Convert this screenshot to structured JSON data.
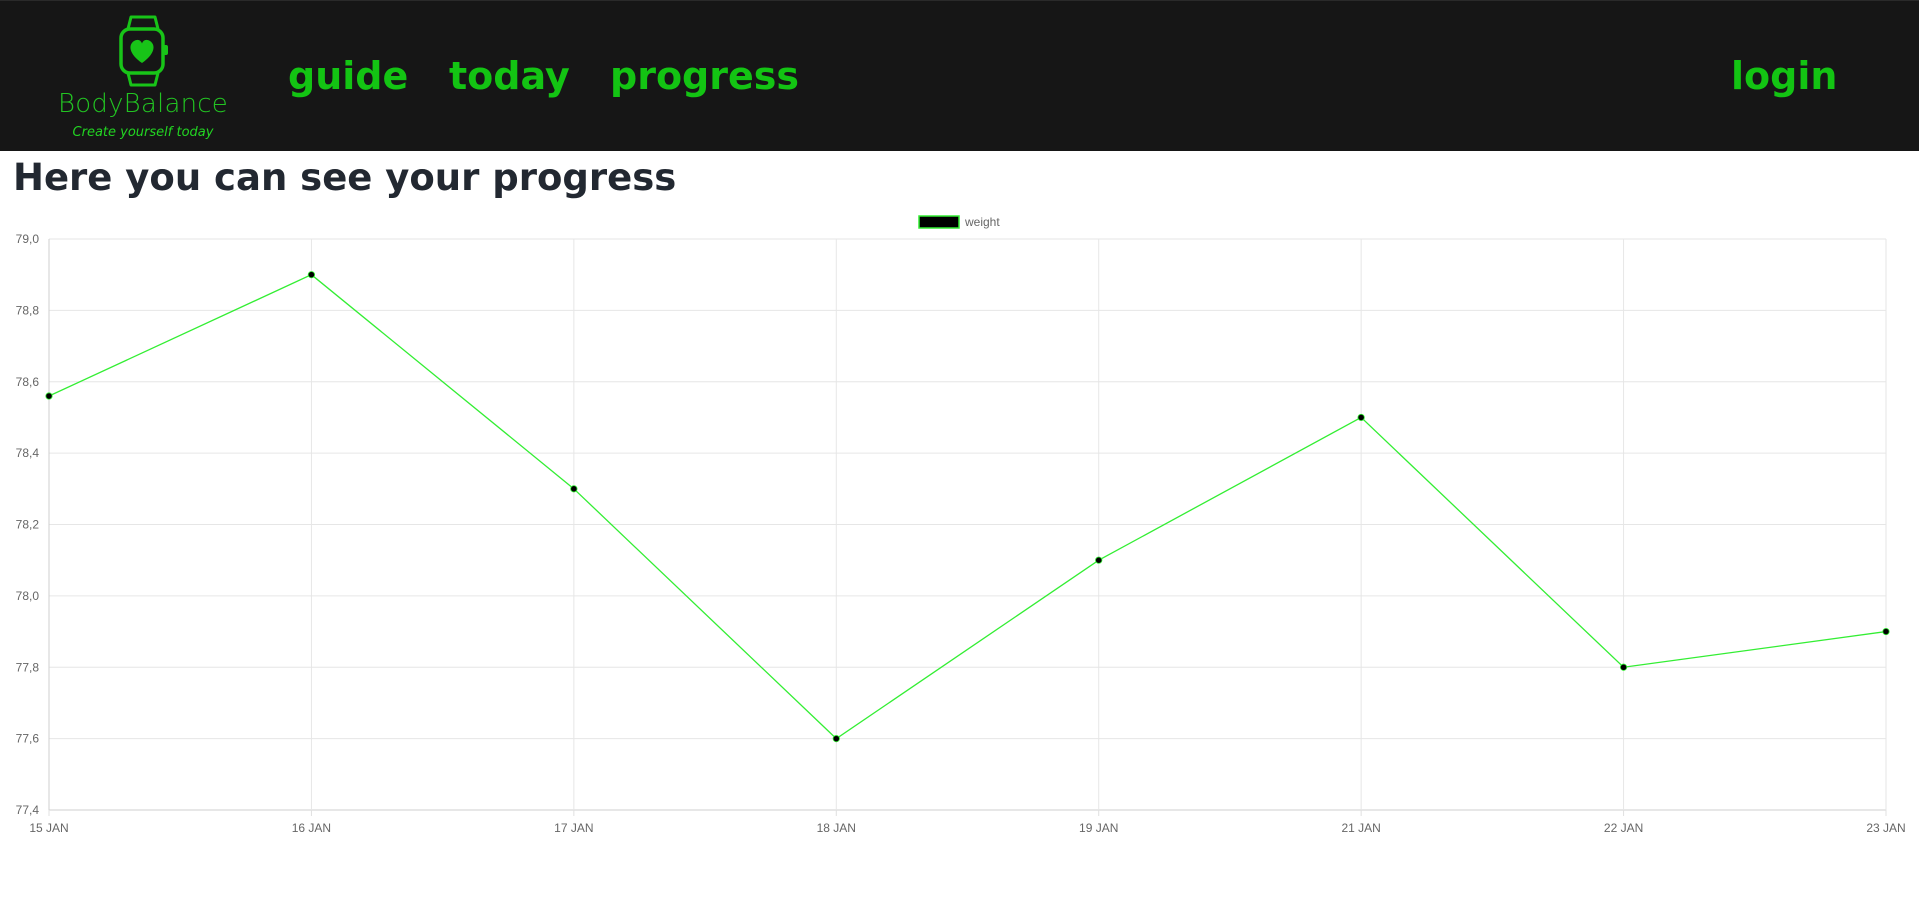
{
  "brand": {
    "name": "BodyBalance",
    "tagline": "Create yourself today",
    "logo_icon": "smartwatch-heart-icon"
  },
  "nav": {
    "guide": "guide",
    "today": "today",
    "progress": "progress",
    "login": "login"
  },
  "colors": {
    "header_bg": "#161616",
    "accent_green": "#13c413",
    "title_text": "#222831",
    "line_color": "#33ee33",
    "point_color": "#000000"
  },
  "main": {
    "title": "Here you can see your progress"
  },
  "chart_data": {
    "type": "line",
    "x": [
      "15 JAN",
      "16 JAN",
      "17 JAN",
      "18 JAN",
      "19 JAN",
      "21 JAN",
      "22 JAN",
      "23 JAN"
    ],
    "series": [
      {
        "name": "weight",
        "values": [
          78.56,
          78.9,
          78.3,
          77.6,
          78.1,
          78.5,
          77.8,
          77.9
        ]
      }
    ],
    "ylim": [
      77.4,
      79.0
    ],
    "yticks": [
      "77,4",
      "77,6",
      "77,8",
      "78,0",
      "78,2",
      "78,4",
      "78,6",
      "78,8",
      "79,0"
    ],
    "legend": "top-center",
    "grid": true,
    "title": "",
    "xlabel": "",
    "ylabel": ""
  }
}
